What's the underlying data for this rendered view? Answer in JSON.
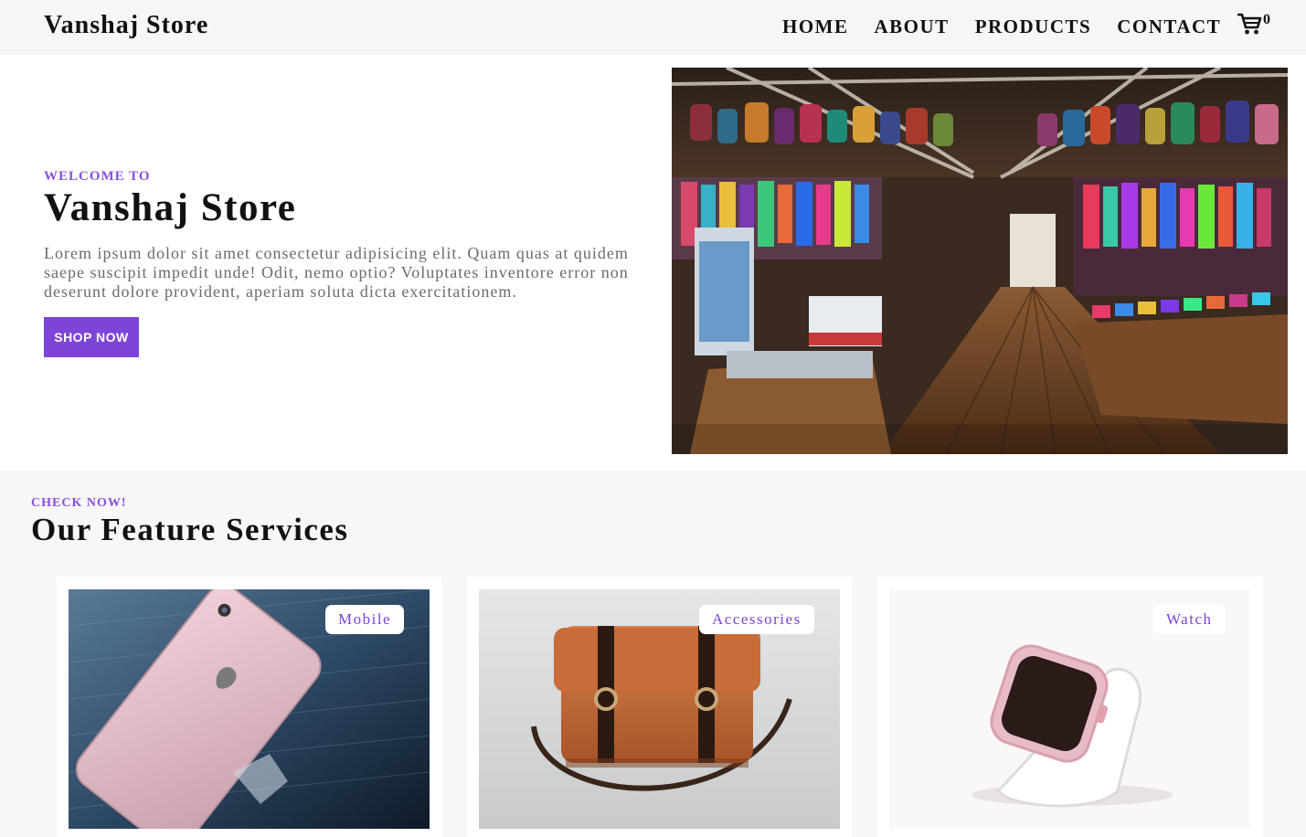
{
  "navbar": {
    "brand": "Vanshaj Store",
    "links": [
      {
        "label": "HOME"
      },
      {
        "label": "ABOUT"
      },
      {
        "label": "PRODUCTS"
      },
      {
        "label": "CONTACT"
      }
    ],
    "cart_count": "0",
    "cart_icon": "shopping-cart-icon"
  },
  "hero": {
    "welcome": "WELCOME TO",
    "title": "Vanshaj Store",
    "text": "Lorem ipsum dolor sit amet consectetur adipisicing elit. Quam quas at quidem saepe suscipit impedit unde! Odit, nemo optio? Voluptates inventore error non deserunt dolore provident, aperiam soluta dicta exercitationem.",
    "button": "SHOP NOW"
  },
  "features": {
    "eyebrow": "CHECK NOW!",
    "title": "Our Feature Services",
    "cards": [
      {
        "tag": "Mobile"
      },
      {
        "tag": "Accessories"
      },
      {
        "tag": "Watch"
      }
    ]
  },
  "colors": {
    "accent": "#7d44d8",
    "eyebrow": "#8a4fe0",
    "navbar_bg": "#f6f6f6",
    "section_bg": "#f7f7f7"
  }
}
